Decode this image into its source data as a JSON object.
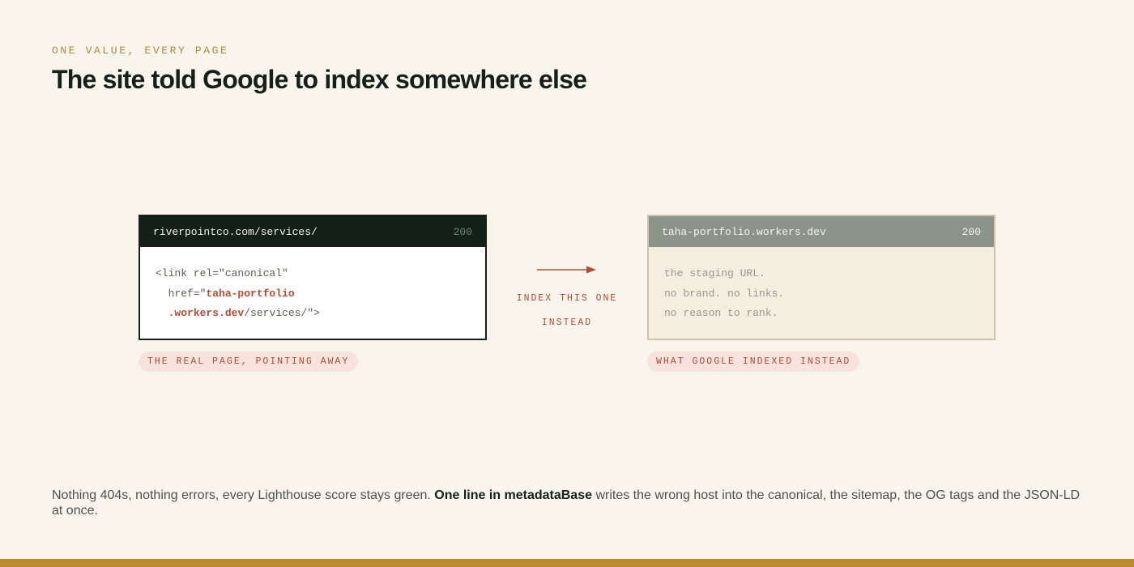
{
  "eyebrow": "ONE VALUE, EVERY PAGE",
  "title": "The site told Google to index somewhere else",
  "real_card": {
    "host": "riverpointco.com/services/",
    "status": "200",
    "code_line1": "<link rel=\"canonical\"",
    "code_line2_pre": "  href=\"",
    "code_line2_hl": "taha-portfolio",
    "code_line3_pre": "  ",
    "code_line3_hl": ".workers.dev",
    "code_line3_post": "/services/\">",
    "caption": "THE REAL PAGE, POINTING AWAY"
  },
  "arrow": {
    "label": "INDEX THIS ONE INSTEAD"
  },
  "staging_card": {
    "host": "taha-portfolio.workers.dev",
    "status": "200",
    "line1": "the staging URL.",
    "line2": "no brand. no links.",
    "line3": "no reason to rank.",
    "caption": "WHAT GOOGLE INDEXED INSTEAD"
  },
  "footer": {
    "text_before": "Nothing 404s, nothing errors, every Lighthouse score stays green. ",
    "emphasis": "One line in metadataBase",
    "text_after": " writes the wrong host into the canonical, the sitemap, the OG tags and the JSON-LD at once."
  },
  "colors": {
    "background": "#faf5ec",
    "accent": "#b44b35",
    "eyebrow": "#a88a3c",
    "dark": "#122019",
    "bottom_bar": "#bd8a2e"
  }
}
